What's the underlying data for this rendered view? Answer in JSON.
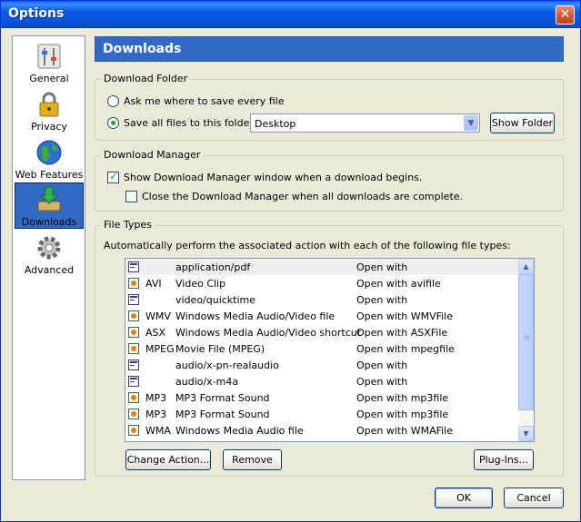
{
  "window": {
    "title": "Options",
    "close_glyph": "✕"
  },
  "nav": {
    "items": [
      {
        "label": "General",
        "icon": "general-icon"
      },
      {
        "label": "Privacy",
        "icon": "lock-icon"
      },
      {
        "label": "Web Features",
        "icon": "globe-icon"
      },
      {
        "label": "Downloads",
        "icon": "download-icon",
        "selected": true
      },
      {
        "label": "Advanced",
        "icon": "gear-icon"
      }
    ]
  },
  "page": {
    "title": "Downloads"
  },
  "download_folder": {
    "legend": "Download Folder",
    "ask_label": "Ask me where to save every file",
    "save_label": "Save all files to this folder:",
    "folder_value": "Desktop",
    "show_folder_button": "Show Folder",
    "selected_option": "save"
  },
  "download_manager": {
    "legend": "Download Manager",
    "show_label": "Show Download Manager window when a download begins.",
    "show_checked": true,
    "close_label": "Close the Download Manager when all downloads are complete.",
    "close_checked": false
  },
  "file_types": {
    "legend": "File Types",
    "description": "Automatically perform the associated action with each of the following file types:",
    "rows": [
      {
        "ext": "",
        "desc": "application/pdf",
        "action": "Open with"
      },
      {
        "ext": "AVI",
        "desc": "Video Clip",
        "action": "Open with avifile"
      },
      {
        "ext": "",
        "desc": "video/quicktime",
        "action": "Open with"
      },
      {
        "ext": "WMV",
        "desc": "Windows Media Audio/Video file",
        "action": "Open with WMVFile"
      },
      {
        "ext": "ASX",
        "desc": "Windows Media Audio/Video shortcut",
        "action": "Open with ASXFile"
      },
      {
        "ext": "MPEG",
        "desc": "Movie File (MPEG)",
        "action": "Open with mpegfile"
      },
      {
        "ext": "",
        "desc": "audio/x-pn-realaudio",
        "action": "Open with"
      },
      {
        "ext": "",
        "desc": "audio/x-m4a",
        "action": "Open with"
      },
      {
        "ext": "MP3",
        "desc": "MP3 Format Sound",
        "action": "Open with mp3file"
      },
      {
        "ext": "MP3",
        "desc": "MP3 Format Sound",
        "action": "Open with mp3file"
      },
      {
        "ext": "WMA",
        "desc": "Windows Media Audio file",
        "action": "Open with WMAFile"
      }
    ],
    "change_action_button": "Change Action...",
    "remove_button": "Remove",
    "plugins_button": "Plug-Ins..."
  },
  "footer": {
    "ok_button": "OK",
    "cancel_button": "Cancel"
  },
  "colors": {
    "accent": "#316ac5",
    "title_bar": "#0754dc",
    "check_green": "#21a121"
  }
}
